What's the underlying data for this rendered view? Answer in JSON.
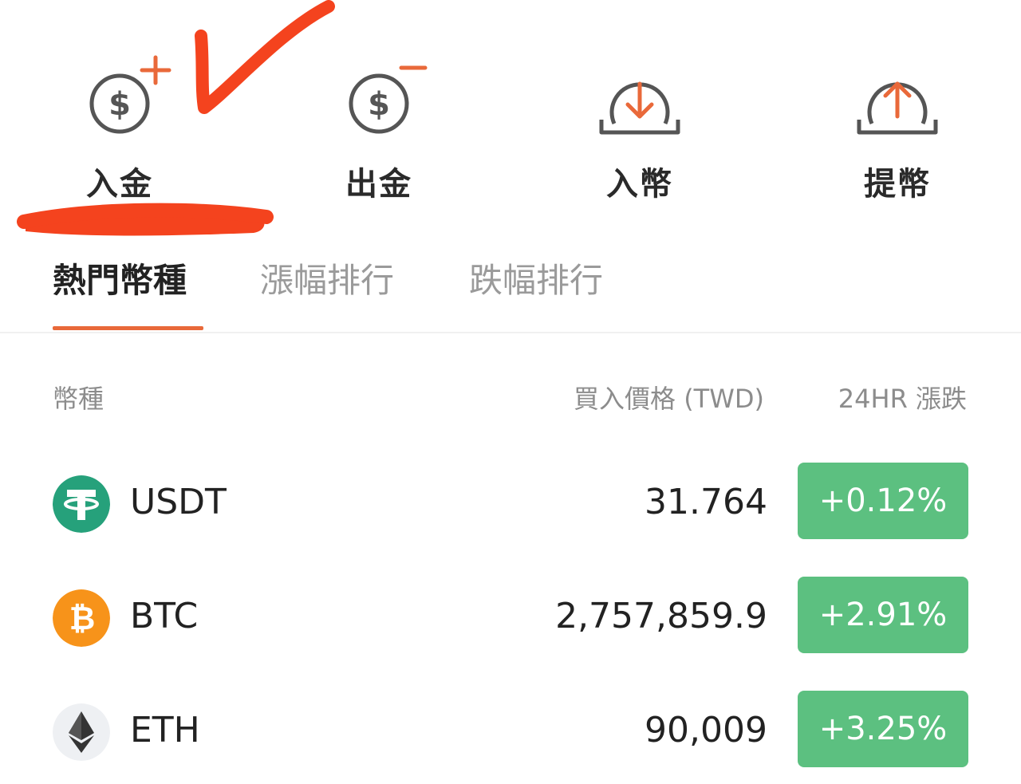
{
  "actions": [
    {
      "label": "入金",
      "icon": "dollar-plus-icon"
    },
    {
      "label": "出金",
      "icon": "dollar-minus-icon"
    },
    {
      "label": "入幣",
      "icon": "coin-deposit-icon"
    },
    {
      "label": "提幣",
      "icon": "coin-withdraw-icon"
    }
  ],
  "tabs": [
    {
      "label": "熱門幣種",
      "active": true
    },
    {
      "label": "漲幅排行",
      "active": false
    },
    {
      "label": "跌幅排行",
      "active": false
    }
  ],
  "table": {
    "headers": {
      "coin": "幣種",
      "price": "買入價格 (TWD)",
      "change": "24HR 漲跌"
    },
    "rows": [
      {
        "symbol": "USDT",
        "icon": "usdt-icon",
        "price": "31.764",
        "change": "+0.12%"
      },
      {
        "symbol": "BTC",
        "icon": "btc-icon",
        "price": "2,757,859.9",
        "change": "+2.91%"
      },
      {
        "symbol": "ETH",
        "icon": "eth-icon",
        "price": "90,009",
        "change": "+3.25%"
      }
    ]
  },
  "colors": {
    "accent": "#e9693a",
    "positive": "#5cc080",
    "annotation": "#f4431e",
    "usdt": "#26a17b",
    "btc": "#f7931a"
  }
}
